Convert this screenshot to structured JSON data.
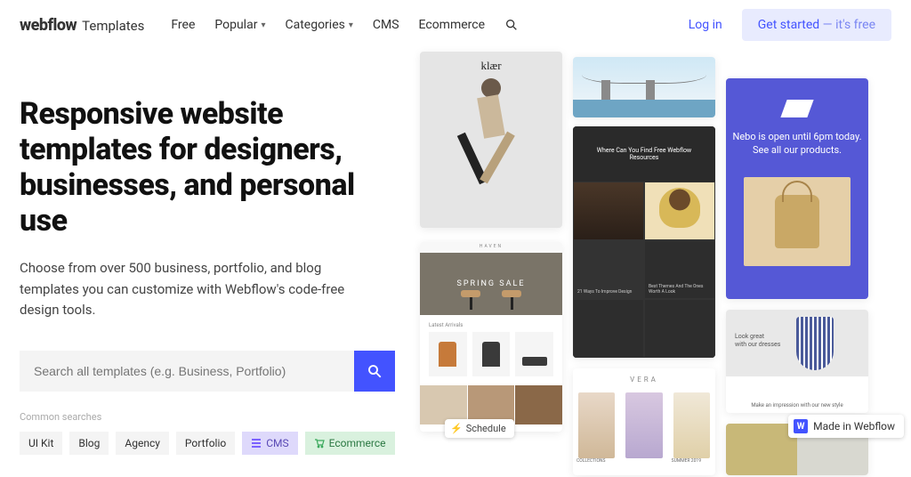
{
  "brand": {
    "main": "webflow",
    "sub": "Templates"
  },
  "nav": {
    "free": "Free",
    "popular": "Popular",
    "categories": "Categories",
    "cms": "CMS",
    "ecommerce": "Ecommerce"
  },
  "auth": {
    "login": "Log in",
    "cta_main": "Get started",
    "cta_sep": " — ",
    "cta_sub": "it's free"
  },
  "hero": {
    "title": "Responsive website templates for designers, businesses, and personal use",
    "subtitle": "Choose from over 500 business, portfolio, and blog templates you can customize with Webflow's code-free design tools."
  },
  "search": {
    "placeholder": "Search all templates (e.g. Business, Portfolio)"
  },
  "common_searches": {
    "label": "Common searches",
    "tags": {
      "uikit": "UI Kit",
      "blog": "Blog",
      "agency": "Agency",
      "portfolio": "Portfolio",
      "cms": "CMS",
      "ecommerce": "Ecommerce"
    }
  },
  "gallery": {
    "klaer_logo": "klær",
    "bridge_caption": "",
    "dark_hero": "Where Can You Find Free Webflow Resources",
    "dark_tiles": {
      "a": "",
      "b": "",
      "c": "21 Ways To Improve Design",
      "d": "Best Themes And The Ones Worth A Look"
    },
    "nebo_line1": "Nebo is open until 6pm today.",
    "nebo_line2": "See all our products.",
    "haven": {
      "brand": "HAVEN",
      "banner": "SPRING SALE",
      "latest": "Latest Arrivals"
    },
    "vera": {
      "brand": "VERA",
      "col_label": "COLLECTIONS",
      "season": "SUMMER 2019"
    },
    "dresses": {
      "line1": "Look great",
      "line2": "with our dresses",
      "sub": "Make an impression with our new style"
    }
  },
  "badges": {
    "schedule": "Schedule",
    "made": "Made in Webflow"
  }
}
